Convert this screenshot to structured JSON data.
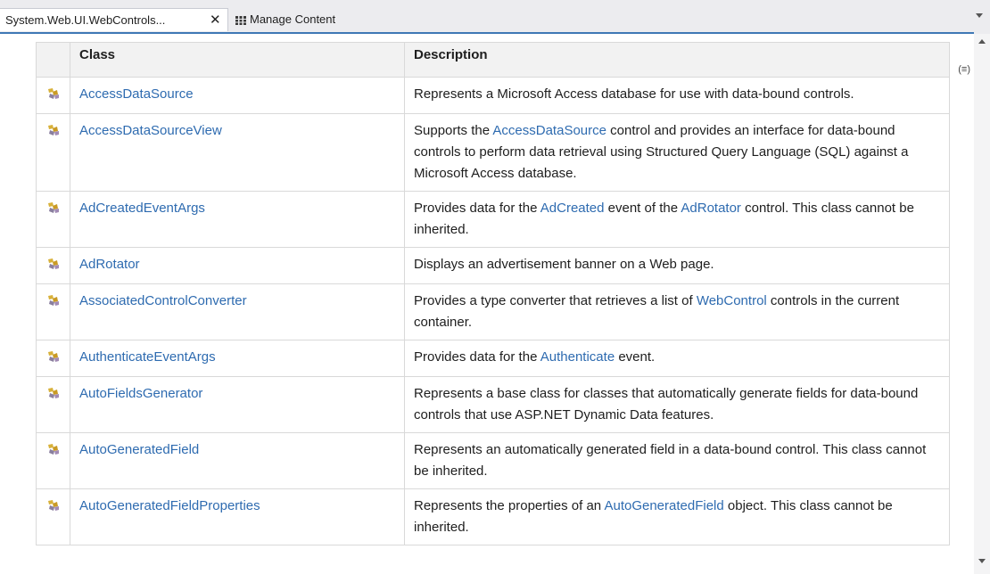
{
  "tabs": [
    {
      "label": "System.Web.UI.WebControls...",
      "active": true,
      "close_glyph": "✕"
    },
    {
      "label": "Manage Content",
      "active": false,
      "icon": "grid-icon"
    }
  ],
  "table": {
    "headers": [
      "Class",
      "Description"
    ],
    "rows": [
      {
        "cls": "AccessDataSource",
        "desc": [
          "Represents a Microsoft Access database for use with data-bound controls."
        ]
      },
      {
        "cls": "AccessDataSourceView",
        "desc": [
          "Supports the ",
          {
            "link": "AccessDataSource"
          },
          " control and provides an interface for data-bound controls to perform data retrieval using Structured Query Language (SQL) against a Microsoft Access database."
        ]
      },
      {
        "cls": "AdCreatedEventArgs",
        "desc": [
          "Provides data for the ",
          {
            "link": "AdCreated"
          },
          " event of the ",
          {
            "link": "AdRotator"
          },
          " control. This class cannot be inherited."
        ]
      },
      {
        "cls": "AdRotator",
        "desc": [
          "Displays an advertisement banner on a Web page."
        ]
      },
      {
        "cls": "AssociatedControlConverter",
        "desc": [
          "Provides a type converter that retrieves a list of ",
          {
            "link": "WebControl"
          },
          " controls in the current container."
        ]
      },
      {
        "cls": "AuthenticateEventArgs",
        "desc": [
          "Provides data for the ",
          {
            "link": "Authenticate"
          },
          " event."
        ]
      },
      {
        "cls": "AutoFieldsGenerator",
        "desc": [
          "Represents a base class for classes that automatically generate fields for data-bound controls that use ASP.NET Dynamic Data features."
        ]
      },
      {
        "cls": "AutoGeneratedField",
        "desc": [
          "Represents an automatically generated field in a data-bound control. This class cannot be inherited."
        ]
      },
      {
        "cls": "AutoGeneratedFieldProperties",
        "desc": [
          "Represents the properties of an ",
          {
            "link": "AutoGeneratedField"
          },
          " object. This class cannot be inherited."
        ]
      }
    ]
  },
  "colors": {
    "link": "#2e6bb0",
    "accent": "#3f78b5",
    "icon": "#d8b13a"
  }
}
